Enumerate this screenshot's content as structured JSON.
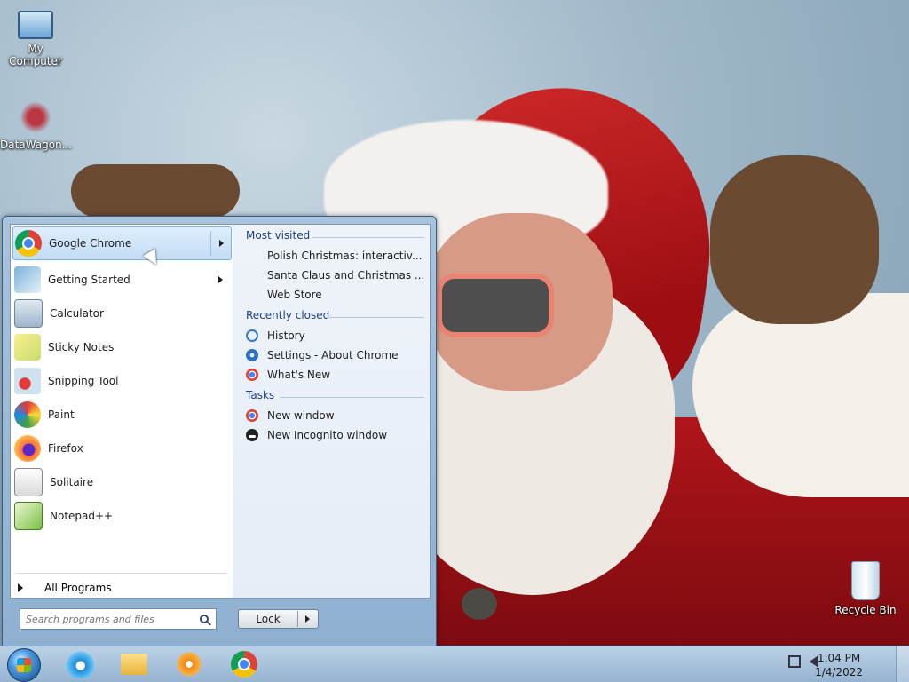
{
  "desktop": {
    "icons": [
      {
        "label": "My Computer",
        "icon": "computer-icon"
      },
      {
        "label": "DataWagon...",
        "icon": "datawagon-icon"
      },
      {
        "label": "Recycle Bin",
        "icon": "recycle-bin-icon"
      }
    ]
  },
  "start_menu": {
    "pinned": [
      {
        "label": "Google Chrome",
        "icon": "chrome-icon",
        "selected": true,
        "has_submenu": true
      },
      {
        "label": "Getting Started",
        "icon": "getting-started-icon",
        "has_submenu": true
      },
      {
        "label": "Calculator",
        "icon": "calculator-icon"
      },
      {
        "label": "Sticky Notes",
        "icon": "sticky-notes-icon"
      },
      {
        "label": "Snipping Tool",
        "icon": "snipping-tool-icon"
      },
      {
        "label": "Paint",
        "icon": "paint-icon"
      },
      {
        "label": "Firefox",
        "icon": "firefox-icon"
      },
      {
        "label": "Solitaire",
        "icon": "solitaire-icon"
      },
      {
        "label": "Notepad++",
        "icon": "notepadpp-icon"
      }
    ],
    "all_programs": "All Programs",
    "jumplist": {
      "most_visited": {
        "heading": "Most visited",
        "items": [
          "Polish Christmas: interactiv...",
          "Santa Claus and Christmas ...",
          "Web Store"
        ]
      },
      "recently_closed": {
        "heading": "Recently closed",
        "items": [
          {
            "label": "History",
            "icon": "history-icon"
          },
          {
            "label": "Settings - About Chrome",
            "icon": "gear-icon"
          },
          {
            "label": "What's New",
            "icon": "chrome-icon"
          }
        ]
      },
      "tasks": {
        "heading": "Tasks",
        "items": [
          {
            "label": "New window",
            "icon": "chrome-icon"
          },
          {
            "label": "New Incognito window",
            "icon": "incognito-icon"
          }
        ]
      }
    },
    "search": {
      "placeholder": "Search programs and files"
    },
    "lock_label": "Lock"
  },
  "taskbar": {
    "pinned": [
      "Internet Explorer",
      "Windows Explorer",
      "Windows Media Player",
      "Google Chrome"
    ],
    "clock": {
      "time": "1:04 PM",
      "date": "1/4/2022"
    }
  },
  "colors": {
    "accent": "#1e3f8a",
    "selection": "#c2dcf5",
    "taskbar": "#9fbcd8"
  }
}
